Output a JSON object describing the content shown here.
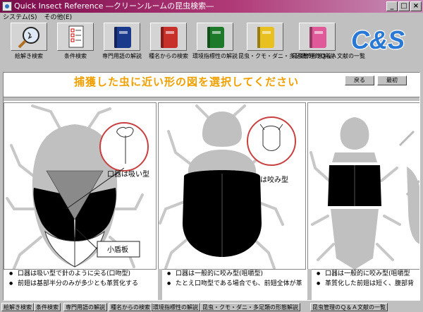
{
  "window": {
    "title": "Quick Insect Reference ―クリーンルームの昆虫検索―"
  },
  "title_buttons": {
    "minimize": "_",
    "maximize": "□",
    "close": "×"
  },
  "menu": [
    "システム(S)",
    "その他(E)"
  ],
  "toolbar": [
    {
      "label": "絵解き検索",
      "icon": "magnifier-icon"
    },
    {
      "label": "条件検索",
      "icon": "checklist-icon"
    },
    {
      "label": "専門用語の解説",
      "icon": "book-navy-icon",
      "color": "#1c3a8c"
    },
    {
      "label": "種名からの検索",
      "icon": "book-red-icon",
      "color": "#c8302a"
    },
    {
      "label": "環境指標性の解説",
      "icon": "book-green-icon",
      "color": "#1d7a2a"
    },
    {
      "label": "昆虫・クモ・ダニ・多足類の形態解説",
      "icon": "book-yellow-icon",
      "color": "#e8c020"
    },
    {
      "label": "昆虫管理のＱ＆Ａ文献の一覧",
      "icon": "book-pink-icon",
      "color": "#e05a9a"
    }
  ],
  "logo": {
    "text": "C&S",
    "color": "#2a78d6"
  },
  "main": {
    "heading": "捕獲した虫に近い形の図を選択してください",
    "back_button": "戻る",
    "first_button": "最初"
  },
  "cards": [
    {
      "mouth_label": "口器は吸い型",
      "callout": "小盾板",
      "notes": [
        "口器は吸い型で針のように尖る(口吻型)",
        "前翅は基部半分のみが多少とも革質化する"
      ]
    },
    {
      "mouth_label": "口器は咬み型",
      "notes": [
        "口器は一般的に咬み型(咀嚼型)",
        "たとえ口吻型である場合でも、前翅全体が革"
      ]
    },
    {
      "notes": [
        "口器は一般的に咬み型(咀嚼型",
        "革質化した前翅は短く、腹部背"
      ]
    }
  ],
  "tabs": [
    "絵解き検索",
    "条件検索",
    "専門用語の解説",
    "種名からの検索",
    "環境指標性の解説",
    "昆虫・クモ・ダニ・多足類の形態解説",
    "昆虫管理のＱ＆Ａ文献の一覧"
  ]
}
